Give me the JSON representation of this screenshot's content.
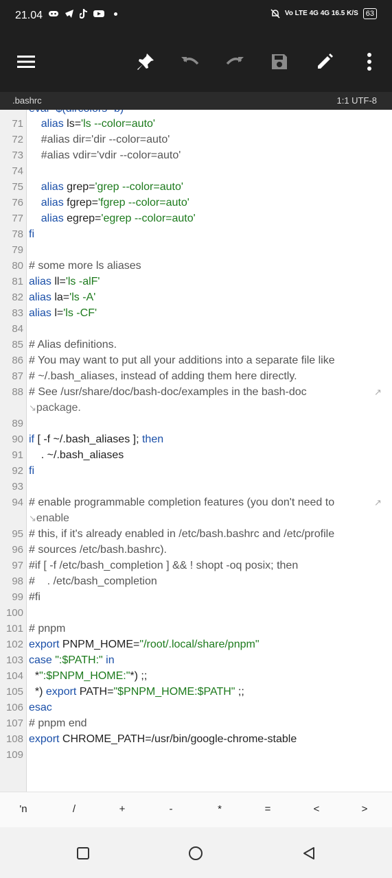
{
  "status_bar": {
    "time": "21.04",
    "right_text": "Vo LTE 4G 4G 16.5 K/S",
    "battery": "63"
  },
  "toolbar": {
    "icons": [
      "menu-icon",
      "pin-icon",
      "undo-icon",
      "redo-icon",
      "save-icon",
      "edit-icon",
      "more-icon"
    ]
  },
  "file_bar": {
    "name": ".bashrc",
    "info": "1:1  UTF-8"
  },
  "editor": {
    "clipped_top": "eval \"$(dircolors -b)\"",
    "lines": [
      {
        "n": "71",
        "t": "    alias ls='ls --color=auto'"
      },
      {
        "n": "72",
        "t": "    #alias dir='dir --color=auto'"
      },
      {
        "n": "73",
        "t": "    #alias vdir='vdir --color=auto'"
      },
      {
        "n": "74",
        "t": ""
      },
      {
        "n": "75",
        "t": "    alias grep='grep --color=auto'"
      },
      {
        "n": "76",
        "t": "    alias fgrep='fgrep --color=auto'"
      },
      {
        "n": "77",
        "t": "    alias egrep='egrep --color=auto'"
      },
      {
        "n": "78",
        "t": "fi"
      },
      {
        "n": "79",
        "t": ""
      },
      {
        "n": "80",
        "t": "# some more ls aliases"
      },
      {
        "n": "81",
        "t": "alias ll='ls -alF'"
      },
      {
        "n": "82",
        "t": "alias la='ls -A'"
      },
      {
        "n": "83",
        "t": "alias l='ls -CF'"
      },
      {
        "n": "84",
        "t": ""
      },
      {
        "n": "85",
        "t": "# Alias definitions."
      },
      {
        "n": "86",
        "t": "# You may want to put all your additions into a separate file like"
      },
      {
        "n": "87",
        "t": "# ~/.bash_aliases, instead of adding them here directly."
      },
      {
        "n": "88",
        "t": "# See /usr/share/doc/bash-doc/examples in the bash-doc"
      },
      {
        "n": "",
        "t": "package."
      },
      {
        "n": "89",
        "t": ""
      },
      {
        "n": "90",
        "t": "if [ -f ~/.bash_aliases ]; then"
      },
      {
        "n": "91",
        "t": "    . ~/.bash_aliases"
      },
      {
        "n": "92",
        "t": "fi"
      },
      {
        "n": "93",
        "t": ""
      },
      {
        "n": "94",
        "t": "# enable programmable completion features (you don't need to"
      },
      {
        "n": "",
        "t": "enable"
      },
      {
        "n": "95",
        "t": "# this, if it's already enabled in /etc/bash.bashrc and /etc/profile"
      },
      {
        "n": "96",
        "t": "# sources /etc/bash.bashrc)."
      },
      {
        "n": "97",
        "t": "#if [ -f /etc/bash_completion ] && ! shopt -oq posix; then"
      },
      {
        "n": "98",
        "t": "#    . /etc/bash_completion"
      },
      {
        "n": "99",
        "t": "#fi"
      },
      {
        "n": "100",
        "t": ""
      },
      {
        "n": "101",
        "t": "# pnpm"
      },
      {
        "n": "102",
        "t": "export PNPM_HOME=\"/root/.local/share/pnpm\""
      },
      {
        "n": "103",
        "t": "case \":$PATH:\" in"
      },
      {
        "n": "104",
        "t": "  *\":$PNPM_HOME:\"*) ;;"
      },
      {
        "n": "105",
        "t": "  *) export PATH=\"$PNPM_HOME:$PATH\" ;;"
      },
      {
        "n": "106",
        "t": "esac"
      },
      {
        "n": "107",
        "t": "# pnpm end"
      },
      {
        "n": "108",
        "t": "export CHROME_PATH=/usr/bin/google-chrome-stable"
      },
      {
        "n": "109",
        "t": ""
      }
    ]
  },
  "symbol_bar": {
    "keys": [
      "'n",
      "/",
      "+",
      "-",
      "*",
      "=",
      "<",
      ">"
    ]
  },
  "nav_bar": {
    "icons": [
      "recents-icon",
      "home-icon",
      "back-icon"
    ]
  },
  "colors": {
    "toolbar_bg": "#1f1f1f",
    "keyword": "#1a4fa8",
    "string": "#1c7a1c",
    "gutter_bg": "#f0f0f0"
  }
}
